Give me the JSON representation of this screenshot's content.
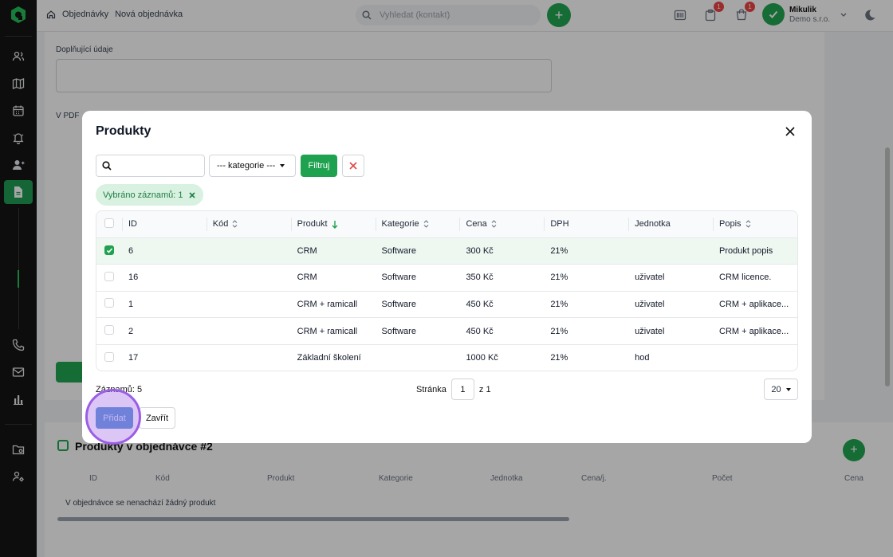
{
  "breadcrumb": {
    "home": "",
    "section": "Objednávky",
    "current": "Nová objednávka"
  },
  "top_search": {
    "placeholder": "Vyhledat (kontakt)"
  },
  "user": {
    "name": "Mikulik",
    "company": "Demo s.r.o."
  },
  "notifications": {
    "badge1": "1",
    "badge2": "1"
  },
  "background": {
    "extra_info_label": "Doplňující údaje",
    "pdf_label": "V PDF",
    "products_section_title": "Produkty v objednávce #2",
    "columns": [
      "ID",
      "Kód",
      "Produkt",
      "Kategorie",
      "Jednotka",
      "Cena/j.",
      "Počet",
      "Cena"
    ],
    "empty_message": "V objednávce se nenachází žádný produkt"
  },
  "modal": {
    "title": "Produkty",
    "category_select": "--- kategorie ---",
    "filter_button": "Filtruj",
    "selected_chip": "Vybráno záznamů: 1",
    "columns": [
      "ID",
      "Kód",
      "Produkt",
      "Kategorie",
      "Cena",
      "DPH",
      "Jednotka",
      "Popis"
    ],
    "rows": [
      {
        "id": "6",
        "code": "",
        "product": "CRM",
        "category": "Software",
        "price": "300 Kč",
        "vat": "21%",
        "unit": "",
        "description": "Produkt popis",
        "selected": true
      },
      {
        "id": "16",
        "code": "",
        "product": "CRM",
        "category": "Software",
        "price": "350 Kč",
        "vat": "21%",
        "unit": "uživatel",
        "description": "CRM licence.",
        "selected": false
      },
      {
        "id": "1",
        "code": "",
        "product": "CRM + ramicall",
        "category": "Software",
        "price": "450 Kč",
        "vat": "21%",
        "unit": "uživatel",
        "description": "CRM + aplikace...",
        "selected": false
      },
      {
        "id": "2",
        "code": "",
        "product": "CRM + ramicall",
        "category": "Software",
        "price": "450 Kč",
        "vat": "21%",
        "unit": "uživatel",
        "description": "CRM + aplikace...",
        "selected": false
      },
      {
        "id": "17",
        "code": "",
        "product": "Základní školení",
        "category": "",
        "price": "1000 Kč",
        "vat": "21%",
        "unit": "hod",
        "description": "",
        "selected": false
      }
    ],
    "records_label": "Záznamů: 5",
    "page_label": "Stránka",
    "page_value": "1",
    "page_of": "z 1",
    "per_page": "20",
    "add_button": "Přidat",
    "close_button": "Zavřít"
  },
  "colors": {
    "accent": "#1fa24f",
    "sidebar": "#141414",
    "add_button": "#5a95d5",
    "click_marker": "#9b5de5"
  }
}
